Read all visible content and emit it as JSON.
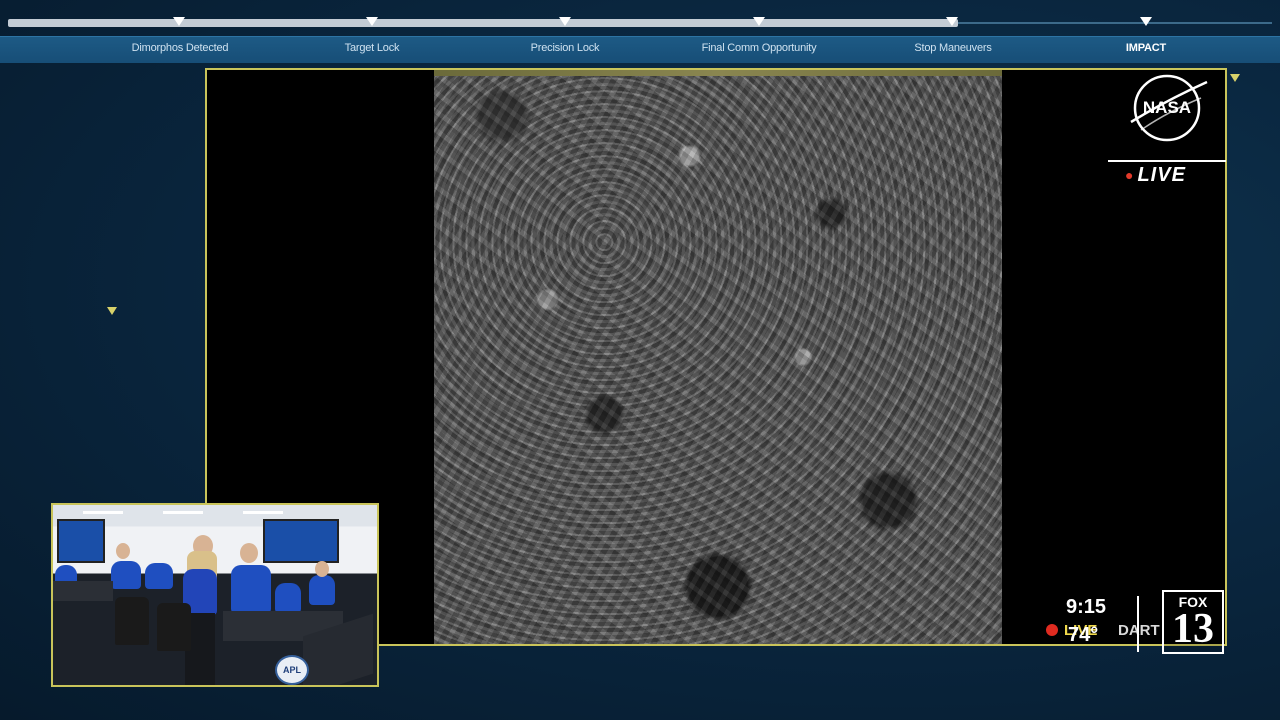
{
  "timeline": {
    "milestones": [
      {
        "label": "Dimorphos Detected",
        "active": false
      },
      {
        "label": "Target Lock",
        "active": false
      },
      {
        "label": "Precision Lock",
        "active": false
      },
      {
        "label": "Final Comm Opportunity",
        "active": false
      },
      {
        "label": "Stop Maneuvers",
        "active": false
      },
      {
        "label": "IMPACT",
        "active": true
      }
    ]
  },
  "broadcast": {
    "network_logo": "NASA",
    "live_label": "LIVE"
  },
  "inset": {
    "badge": "APL"
  },
  "station_bug": {
    "time": "9:15",
    "temperature": "74°",
    "live_label": "LIVE",
    "ticker_text": "DART",
    "station_name": "FOX",
    "channel_number": "13"
  },
  "colors": {
    "frame_border": "#c9c45a",
    "timeline_bar": "#1d5a85",
    "live_dot": "#e23a2a"
  }
}
